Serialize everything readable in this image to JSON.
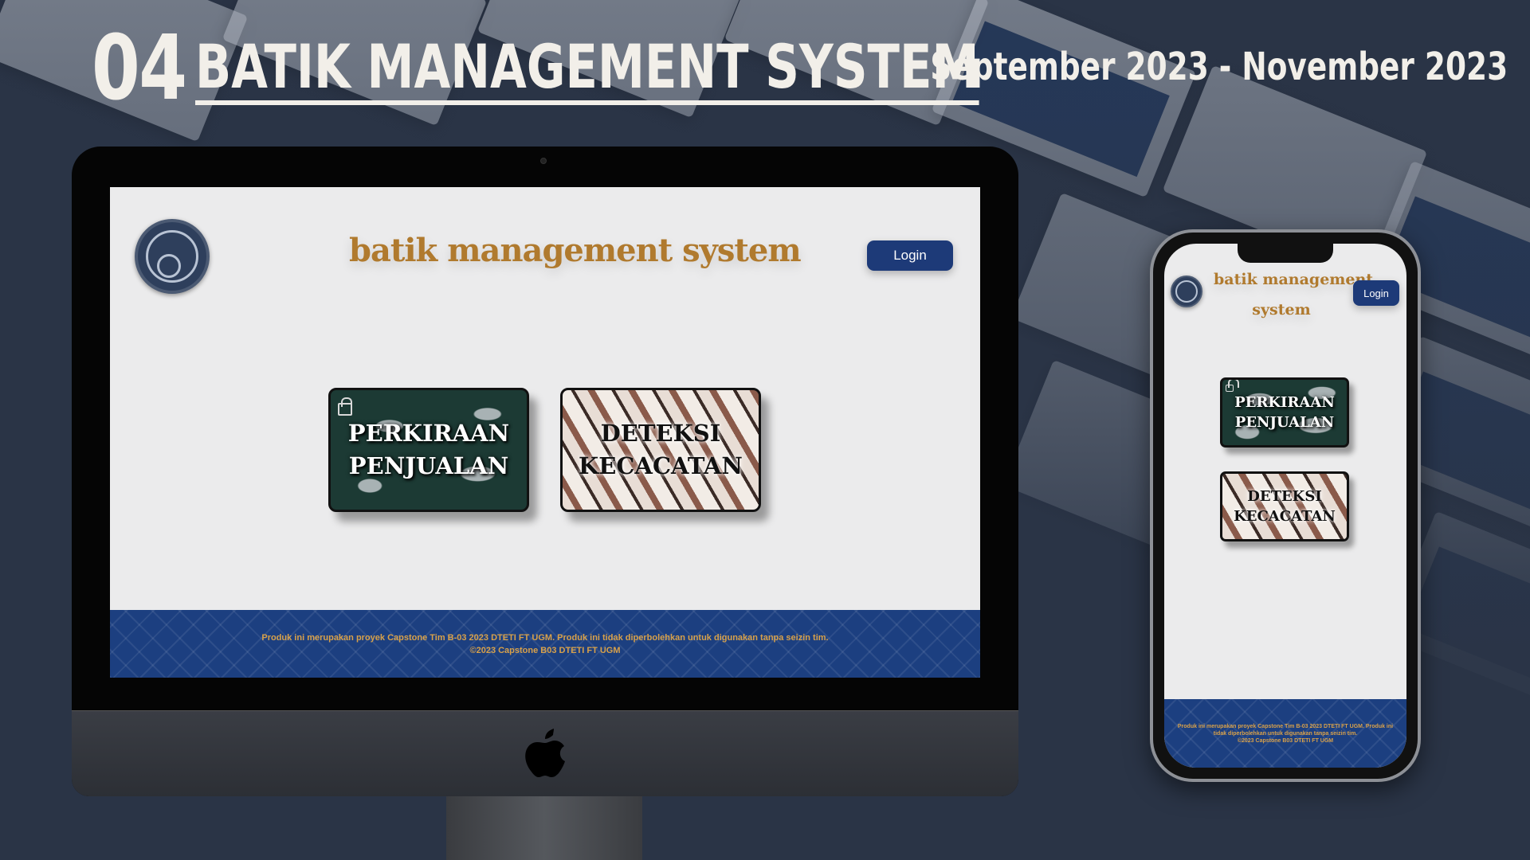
{
  "header": {
    "number": "04",
    "title": "BATIK MANAGEMENT SYSTEM",
    "date_range": "September 2023 - November 2023"
  },
  "desktop": {
    "brand": "batik management system",
    "login_label": "Login",
    "cards": [
      {
        "line1": "PERKIRAAN",
        "line2": "PENJUALAN"
      },
      {
        "line1": "DETEKSI",
        "line2": "KECACATAN"
      }
    ],
    "footer_line1": "Produk ini merupakan proyek Capstone Tim B-03 2023 DTETI FT UGM. Produk ini tidak diperbolehkan untuk digunakan tanpa seizin tim.",
    "footer_line2": "©2023 Capstone B03 DTETI FT UGM"
  },
  "mobile": {
    "brand_line1": "batik management",
    "brand_line2": "system",
    "login_label": "Login",
    "cards": [
      {
        "line1": "PERKIRAAN",
        "line2": "PENJUALAN"
      },
      {
        "line1": "DETEKSI",
        "line2": "KECACATAN"
      }
    ],
    "footer_line1": "Produk ini merupakan proyek Capstone Tim B-03 2023 DTETI FT UGM. Produk ini",
    "footer_line2": "tidak diperbolehkan untuk digunakan tanpa seizin tim.",
    "footer_line3": "©2023 Capstone B03 DTETI FT UGM"
  },
  "colors": {
    "background": "#2a3446",
    "brand_gold": "#b07a2e",
    "login_blue": "#1d3a78",
    "footer_blue": "#1c3f80",
    "footer_text": "#d8a14a"
  },
  "icons": [
    "logo-icon",
    "lock-icon",
    "apple-logo-icon"
  ]
}
